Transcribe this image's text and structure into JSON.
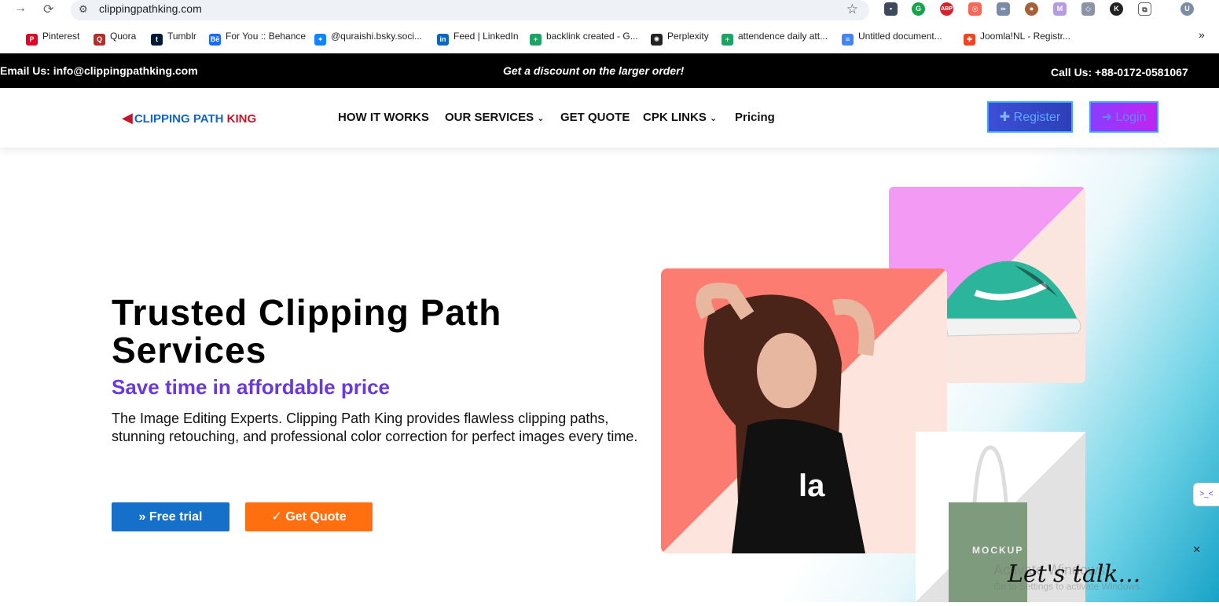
{
  "browser": {
    "url": "clippingpathking.com",
    "bookmarks": [
      {
        "label": "Pinterest",
        "icon": "pinterest-icon",
        "color": "#e60023",
        "glyph": "P"
      },
      {
        "label": "Quora",
        "icon": "quora-icon",
        "color": "#b92b27",
        "glyph": "Q"
      },
      {
        "label": "Tumblr",
        "icon": "tumblr-icon",
        "color": "#001935",
        "glyph": "t"
      },
      {
        "label": "For You :: Behance",
        "icon": "behance-icon",
        "color": "#1769ff",
        "glyph": "Bē"
      },
      {
        "label": "@quraishi.bsky.soci...",
        "icon": "bluesky-icon",
        "color": "#1185fe",
        "glyph": "✦"
      },
      {
        "label": "Feed | LinkedIn",
        "icon": "linkedin-icon",
        "color": "#0a66c2",
        "glyph": "in"
      },
      {
        "label": "backlink created - G...",
        "icon": "sheets-icon",
        "color": "#1ea362",
        "glyph": "+"
      },
      {
        "label": "Perplexity",
        "icon": "perplexity-icon",
        "color": "#222222",
        "glyph": "✺"
      },
      {
        "label": "attendence daily att...",
        "icon": "sheets-icon",
        "color": "#1ea362",
        "glyph": "+"
      },
      {
        "label": "Untitled document...",
        "icon": "docs-icon",
        "color": "#4285f4",
        "glyph": "≡"
      },
      {
        "label": "Joomla!NL - Registr...",
        "icon": "joomla-icon",
        "color": "#f44321",
        "glyph": "✚"
      }
    ],
    "more_bookmarks": "»"
  },
  "topbar": {
    "email": "Email Us: info@clippingpathking.com",
    "promo": "Get a discount on the larger order!",
    "phone": "Call Us: +88-0172-0581067"
  },
  "header": {
    "logo_prefix": "CLIPPING PATH ",
    "logo_suffix": "KING",
    "menu": [
      {
        "label": "HOW IT WORKS",
        "dropdown": false
      },
      {
        "label": "OUR SERVICES",
        "dropdown": true
      },
      {
        "label": "GET QUOTE",
        "dropdown": false
      },
      {
        "label": "CPK LINKS",
        "dropdown": true
      },
      {
        "label": "Pricing",
        "dropdown": false
      }
    ],
    "register_label": "Register",
    "login_label": "Login"
  },
  "hero": {
    "title_line1": "Trusted Clipping Path",
    "title_line2": "Services",
    "subtitle": "Save time in affordable price",
    "description": "The Image Editing Experts. Clipping Path King provides flawless clipping paths, stunning retouching, and professional color correction for perfect images every time.",
    "free_trial_label": "Free trial",
    "get_quote_label": "Get Quote",
    "mockup_label": "MOCKUP"
  },
  "overlay": {
    "windows_line1": "Activate Windows",
    "windows_line2": "Go to Settings to activate Windows.",
    "chat_label": "Let's talk...",
    "close": "×"
  },
  "colors": {
    "accent_purple": "#6a39d9",
    "trial_blue": "#1570c9",
    "quote_orange": "#ff6f0f"
  }
}
